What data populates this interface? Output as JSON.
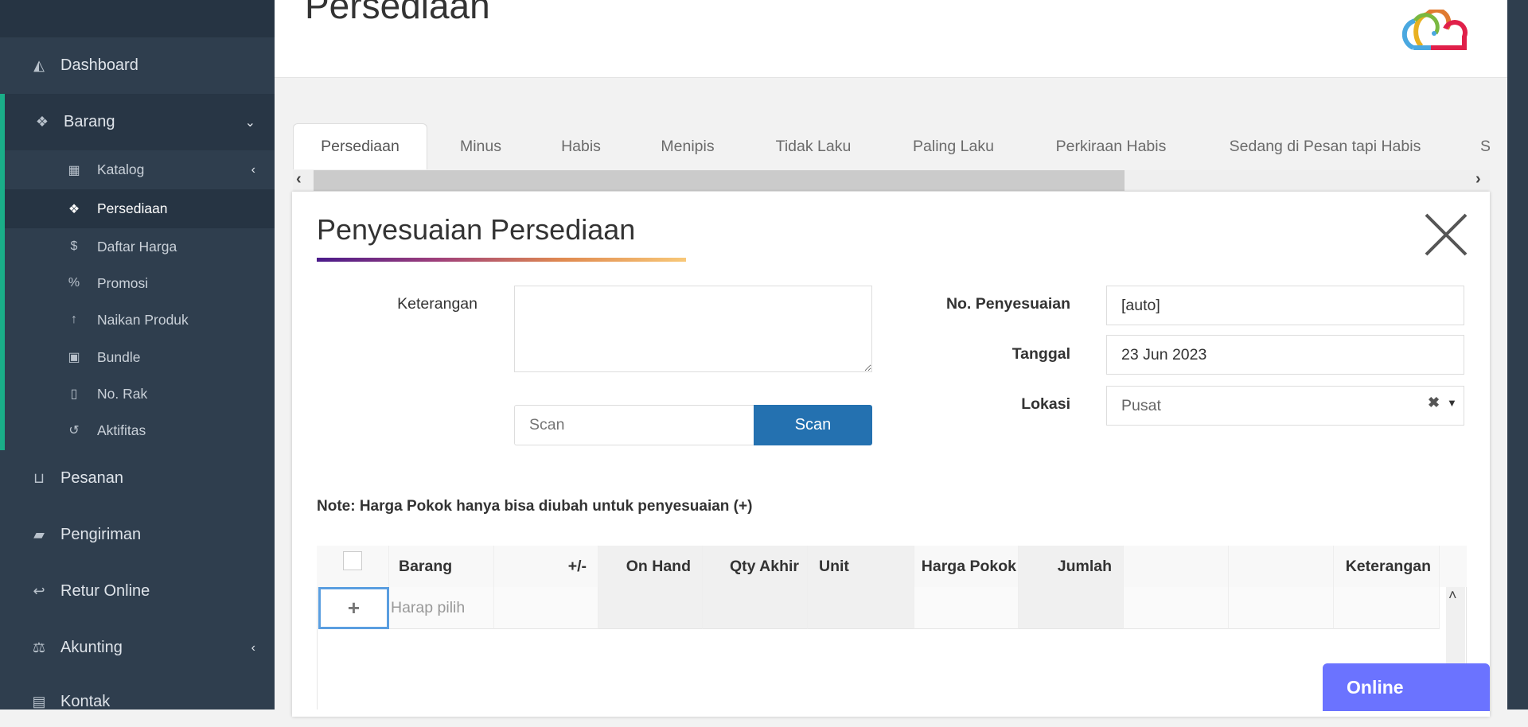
{
  "sidebar": {
    "items": [
      {
        "label": "Dashboard",
        "icon": "area-chart-icon"
      },
      {
        "label": "Barang",
        "icon": "cubes-icon"
      },
      {
        "label": "Katalog",
        "icon": "grid-icon"
      },
      {
        "label": "Persediaan",
        "icon": "cubes-icon"
      },
      {
        "label": "Daftar Harga",
        "icon": "dollar-icon"
      },
      {
        "label": "Promosi",
        "icon": "percent-icon"
      },
      {
        "label": "Naikan Produk",
        "icon": "arrow-up-icon"
      },
      {
        "label": "Bundle",
        "icon": "th-large-icon"
      },
      {
        "label": "No. Rak",
        "icon": "bookmark-icon"
      },
      {
        "label": "Aktifitas",
        "icon": "history-icon"
      },
      {
        "label": "Pesanan",
        "icon": "basket-icon"
      },
      {
        "label": "Pengiriman",
        "icon": "truck-icon"
      },
      {
        "label": "Retur Online",
        "icon": "reply-icon"
      },
      {
        "label": "Akunting",
        "icon": "balance-scale-icon"
      },
      {
        "label": "Kontak",
        "icon": "address-card-icon"
      }
    ]
  },
  "header": {
    "title": "Persediaan"
  },
  "tabs": [
    "Persediaan",
    "Minus",
    "Habis",
    "Menipis",
    "Tidak Laku",
    "Paling Laku",
    "Perkiraan Habis",
    "Sedang di Pesan tapi Habis",
    "S"
  ],
  "modal": {
    "title": "Penyesuaian Persediaan",
    "keterangan_label": "Keterangan",
    "scan_placeholder": "Scan",
    "scan_button": "Scan",
    "no_label": "No. Penyesuaian",
    "no_value": "[auto]",
    "tanggal_label": "Tanggal",
    "tanggal_value": "23 Jun 2023",
    "lokasi_label": "Lokasi",
    "lokasi_value": "Pusat",
    "note": "Note: Harga Pokok hanya bisa diubah untuk penyesuaian (+)",
    "table": {
      "headers": [
        "Barang",
        "+/-",
        "On Hand",
        "Qty Akhir",
        "Unit",
        "Harga Pokok",
        "Jumlah",
        "",
        "",
        "Keterangan"
      ],
      "row_placeholder": "Harap pilih"
    }
  },
  "online_button": "Online",
  "colors": {
    "sidebar": "#2f3e4e",
    "accent_green": "#1aae88",
    "scan_button": "#2471b0",
    "online": "#6b73ff"
  }
}
